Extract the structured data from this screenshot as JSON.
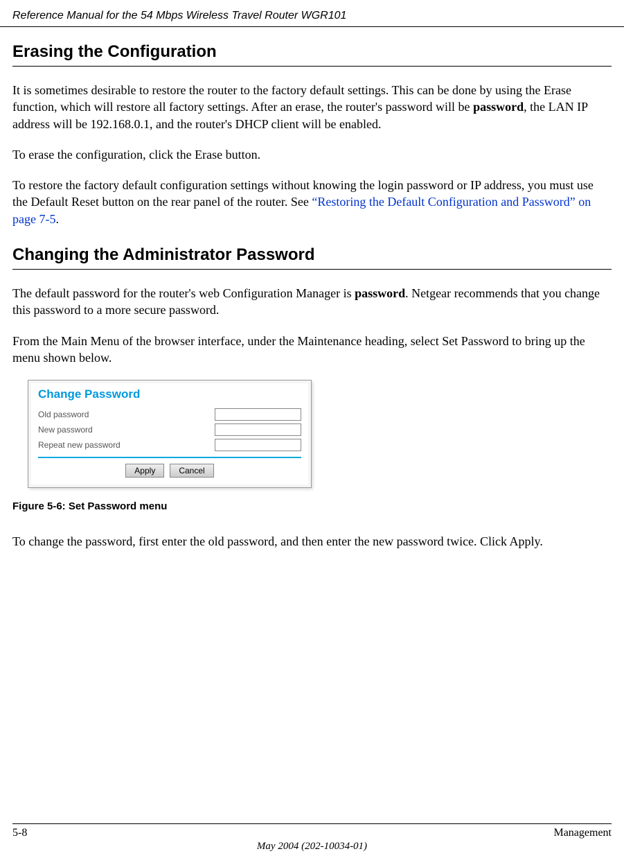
{
  "header": {
    "title": "Reference Manual for the 54 Mbps Wireless Travel Router WGR101"
  },
  "section1": {
    "heading": "Erasing the Configuration",
    "p1_pre": "It is sometimes desirable to restore the router to the factory default settings. This can be done by using the Erase function, which will restore all factory settings. After an erase, the router's password will be ",
    "p1_bold": "password",
    "p1_post": ", the LAN IP address will be 192.168.0.1, and the router's DHCP client will be enabled.",
    "p2": "To erase the configuration, click the Erase button.",
    "p3_pre": "To restore the factory default configuration settings without knowing the login password or IP address, you must use the Default Reset button on the rear panel of the router. See ",
    "p3_link": "“Restoring the Default Configuration and Password” on page 7-5",
    "p3_post": "."
  },
  "section2": {
    "heading": "Changing the Administrator Password",
    "p1_pre": "The default password for the router's web Configuration Manager is ",
    "p1_bold": "password",
    "p1_post": ". Netgear recommends that you change this password to a more secure password.",
    "p2": "From the Main Menu of the browser interface, under the Maintenance heading, select Set Password to bring up the menu shown below.",
    "p3": "To change the password, first enter the old password, and then enter the new password twice. Click Apply."
  },
  "figure": {
    "title": "Change Password",
    "old_label": "Old password",
    "new_label": "New password",
    "repeat_label": "Repeat new password",
    "apply": "Apply",
    "cancel": "Cancel",
    "caption": "Figure 5-6:  Set Password menu"
  },
  "footer": {
    "page": "5-8",
    "chapter": "Management",
    "date": "May 2004 (202-10034-01)"
  }
}
